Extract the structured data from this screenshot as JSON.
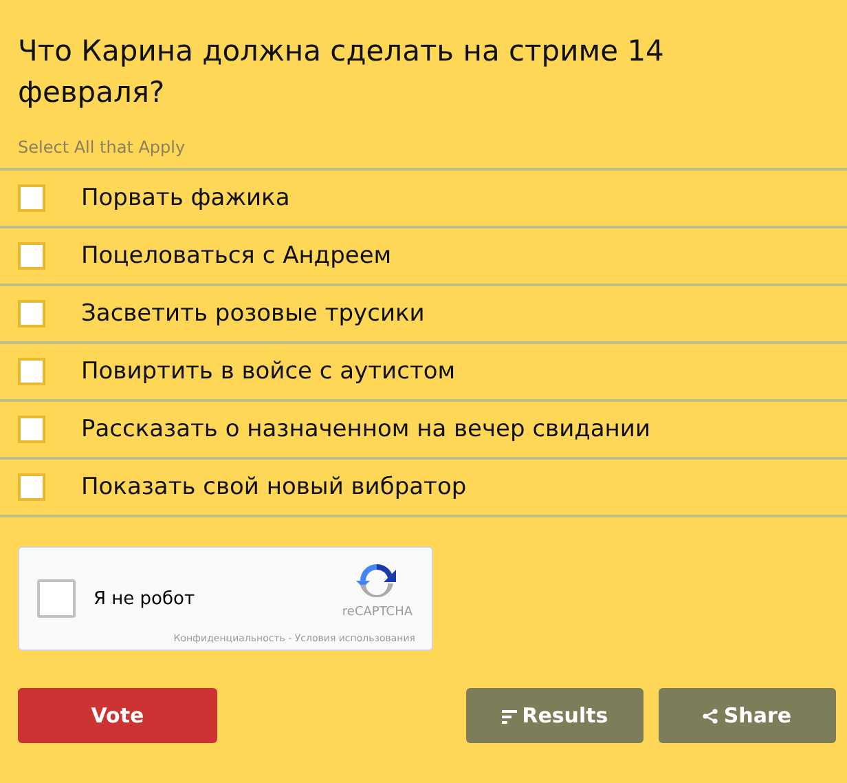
{
  "question": "Что Карина должна сделать на стриме 14 февраля?",
  "hint": "Select All that Apply",
  "options": [
    {
      "label": "Порвать фажика",
      "checked": false
    },
    {
      "label": "Поцеловаться с Андреем",
      "checked": false
    },
    {
      "label": "Засветить розовые трусики",
      "checked": false
    },
    {
      "label": "Повиртить в войсе с аутистом",
      "checked": false
    },
    {
      "label": "Рассказать о назначенном на вечер свидании",
      "checked": false
    },
    {
      "label": "Показать свой новый вибратор",
      "checked": false
    }
  ],
  "captcha": {
    "label": "Я не робот",
    "checked": false,
    "brand": "reCAPTCHA",
    "links": "Конфиденциальность - Условия использования"
  },
  "buttons": [
    {
      "label": "Vote",
      "kind": "vote"
    },
    {
      "label": "Results",
      "kind": "results"
    },
    {
      "label": "Share",
      "kind": "share"
    }
  ]
}
